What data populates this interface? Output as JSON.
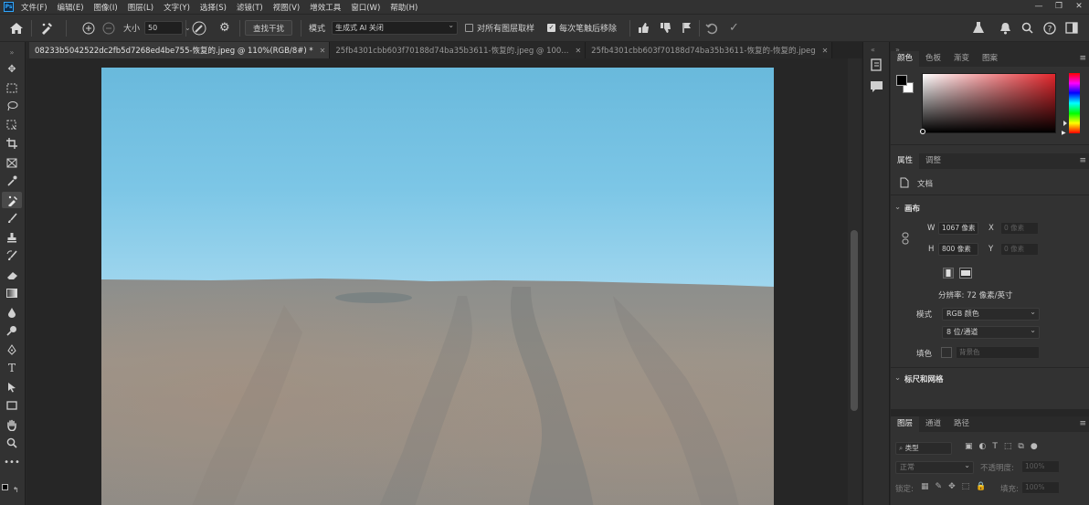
{
  "app": {
    "logo": "Ps"
  },
  "menu": [
    "文件(F)",
    "编辑(E)",
    "图像(I)",
    "图层(L)",
    "文字(Y)",
    "选择(S)",
    "滤镜(T)",
    "视图(V)",
    "增效工具",
    "窗口(W)",
    "帮助(H)"
  ],
  "window_controls": [
    "—",
    "❐",
    "✕"
  ],
  "options": {
    "size_label": "大小",
    "size_value": "50",
    "find_button": "查找干扰",
    "mode_label": "模式",
    "mode_value": "生成式 AI 关闭",
    "sample_all_layers": "对所有图层取样",
    "sample_all_checked": false,
    "remove_after_stroke": "每次笔触后移除",
    "remove_after_checked": true
  },
  "tabs": [
    {
      "label": "08233b5042522dc2fb5d7268ed4be755-恢复的.jpeg @ 110%(RGB/8#) *",
      "active": true
    },
    {
      "label": "25fb4301cbb603f70188d74ba35b3611-恢复的.jpeg @ 100...",
      "active": false
    },
    {
      "label": "25fb4301cbb603f70188d74ba35b3611-恢复的-恢复的.jpeg",
      "active": false
    }
  ],
  "color_panel": {
    "tabs": [
      "颜色",
      "色板",
      "渐变",
      "图案"
    ],
    "active_tab": 0,
    "foreground": "#000000",
    "background": "#ffffff",
    "hue_color": "#e3262c"
  },
  "properties_panel": {
    "tabs": [
      "属性",
      "调整"
    ],
    "active_tab": 0,
    "doc_label": "文档",
    "canvas_section": "画布",
    "w_label": "W",
    "w_value": "1067 像素",
    "h_label": "H",
    "h_value": "800 像素",
    "x_label": "X",
    "x_value": "0 像素",
    "y_label": "Y",
    "y_value": "0 像素",
    "resolution": "分辨率: 72 像素/英寸",
    "mode_label": "模式",
    "mode_value": "RGB 颜色",
    "depth_value": "8 位/通道",
    "fill_label": "填色",
    "fill_value": "背景色",
    "rulers_section": "标尺和网格"
  },
  "layers_panel": {
    "tabs": [
      "图层",
      "通道",
      "路径"
    ],
    "active_tab": 0,
    "kind_label": "类型",
    "blend_value": "正常",
    "opacity_label": "不透明度:",
    "opacity_value": "100%",
    "lock_label": "锁定:",
    "fill_label": "填充:",
    "fill_value": "100%"
  }
}
